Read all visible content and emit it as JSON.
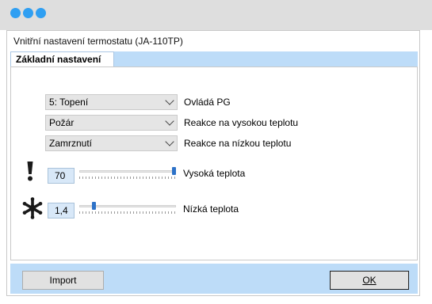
{
  "window": {
    "traffic_light_color": "#2f9ff2"
  },
  "dialog": {
    "title": "Vnitřní nastavení termostatu (JA-110TP)"
  },
  "tabs": [
    {
      "label": "Základní nastavení",
      "active": true
    }
  ],
  "settings": [
    {
      "value": "5: Topení",
      "label": "Ovládá PG"
    },
    {
      "value": "Požár",
      "label": "Reakce na vysokou teplotu"
    },
    {
      "value": "Zamrznutí",
      "label": "Reakce na nízkou teplotu"
    }
  ],
  "sliders": [
    {
      "icon": "exclamation-icon",
      "value": "70",
      "label": "Vysoká teplota",
      "level": 1.0
    },
    {
      "icon": "snowflake-icon",
      "value": "1,4",
      "label": "Nízká teplota",
      "level": 0.14
    }
  ],
  "buttons": {
    "import": "Import",
    "ok": "OK"
  },
  "colors": {
    "accent": "#bddcf8",
    "thumb": "#2d72c8"
  }
}
